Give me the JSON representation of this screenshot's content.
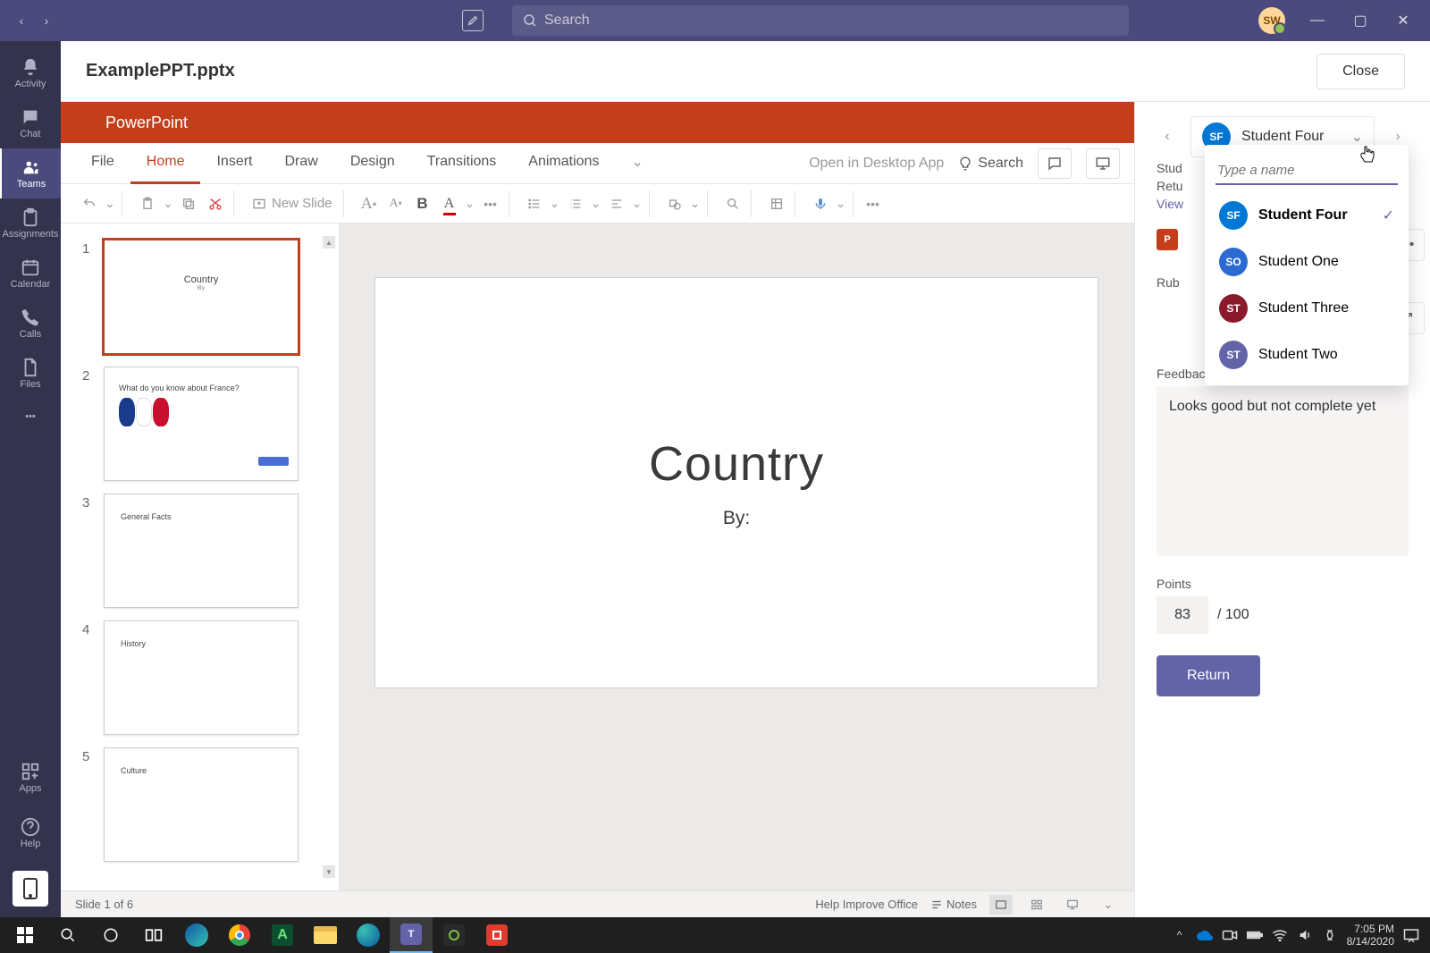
{
  "titlebar": {
    "search_placeholder": "Search",
    "avatar_initials": "SW"
  },
  "rail": {
    "items": [
      {
        "label": "Activity"
      },
      {
        "label": "Chat"
      },
      {
        "label": "Teams"
      },
      {
        "label": "Assignments"
      },
      {
        "label": "Calendar"
      },
      {
        "label": "Calls"
      },
      {
        "label": "Files"
      }
    ],
    "apps": "Apps",
    "help": "Help"
  },
  "file": {
    "name": "ExamplePPT.pptx",
    "close": "Close"
  },
  "ppt": {
    "brand": "PowerPoint",
    "tabs": [
      "File",
      "Home",
      "Insert",
      "Draw",
      "Design",
      "Transitions",
      "Animations"
    ],
    "open_desktop": "Open in Desktop App",
    "search": "Search",
    "new_slide": "New Slide",
    "status_left": "Slide 1 of 6",
    "status_help": "Help Improve Office",
    "status_notes": "Notes",
    "thumbs": [
      {
        "title": "Country",
        "sub": "By"
      },
      {
        "title": "What do you know about France?"
      },
      {
        "title": "General Facts"
      },
      {
        "title": "History"
      },
      {
        "title": "Culture"
      }
    ],
    "slide": {
      "title": "Country",
      "sub": "By:"
    }
  },
  "grading": {
    "student_name": "Student Four",
    "student_initials": "SF",
    "student_color": "#0078d4",
    "search_placeholder": "Type a name",
    "students": [
      {
        "initials": "SF",
        "name": "Student Four",
        "color": "#0078d4",
        "selected": true
      },
      {
        "initials": "SO",
        "name": "Student One",
        "color": "#2b6bd1",
        "selected": false
      },
      {
        "initials": "ST",
        "name": "Student Three",
        "color": "#8a1a2b",
        "selected": false
      },
      {
        "initials": "ST",
        "name": "Student Two",
        "color": "#6264a7",
        "selected": false
      }
    ],
    "hidden_labels": {
      "stud": "Stud",
      "retu": "Retu",
      "view": "View",
      "rub": "Rub"
    },
    "feedback_label": "Feedback",
    "feedback_value": "Looks good but not complete yet",
    "points_label": "Points",
    "points_value": "83",
    "points_total": "/ 100",
    "return": "Return"
  },
  "taskbar": {
    "time": "7:05 PM",
    "date": "8/14/2020"
  }
}
